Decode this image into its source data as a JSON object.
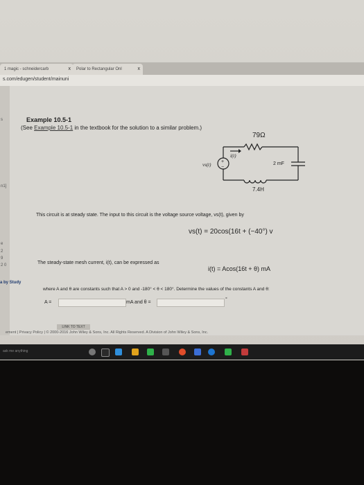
{
  "tabs": [
    {
      "label": "1 magic - schneidercarb",
      "close": "x"
    },
    {
      "label": "Polar to Rectangular Onl",
      "close": "x"
    }
  ],
  "url": "s.com/edugen/student/mainuni",
  "left_strip": [
    "s",
    "n1]",
    "e",
    "2",
    "9",
    "2 0"
  ],
  "example": {
    "title": "Example 10.5-1",
    "see_prefix": "(See",
    "see_link": "Example 10.5-1",
    "see_suffix": "in the textbook for the solution to a similar problem.)"
  },
  "circuit": {
    "resistor": "79Ω",
    "capacitor": "2 mF",
    "inductor": "7.4H",
    "current": "i(t)",
    "source": "vs(t)",
    "plus": "+",
    "minus": "−"
  },
  "problem": {
    "intro": "This circuit is at steady state. The input to this circuit is the voltage source voltage, vs(t), given by",
    "eq1": "vs(t) = 20cos(16t + (−40°) v",
    "ss_text": "The steady-state mesh current, i(t), can be expressed as",
    "eq2": "i(t) = Acos(16t + θ)  mA",
    "where": "where A and θ are constants such that A > 0 and -180° < θ < 180°. Determine the values of the constants A and θ:",
    "a_label": "A =",
    "ma_and": "mA and θ =",
    "theta_unit": "°"
  },
  "by_study": "a by Study",
  "link_btn": "LINK TO TEXT",
  "footer": "ement  |  Privacy Policy  |  © 2000-2016 John Wiley & Sons, Inc. All Rights Reserved. A Division of John Wiley & Sons, Inc.",
  "taskbar_left": "ask me anything"
}
